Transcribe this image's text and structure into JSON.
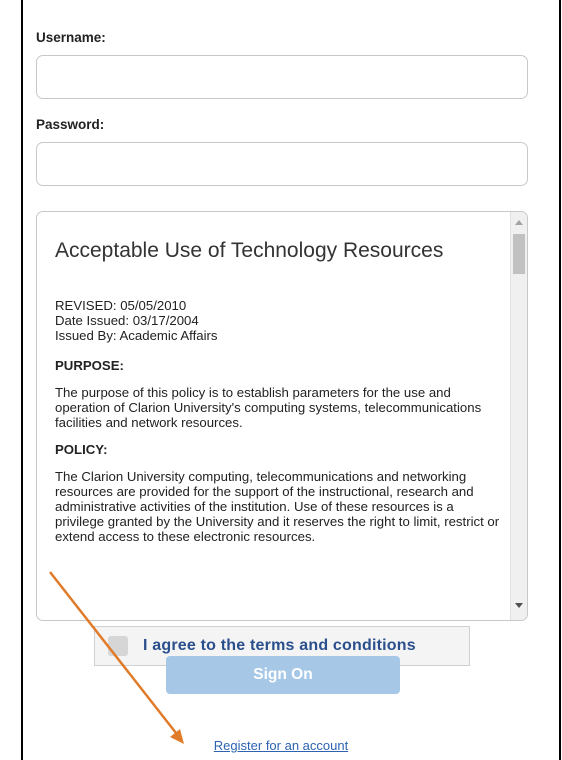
{
  "login": {
    "username_label": "Username:",
    "password_label": "Password:",
    "username_value": "",
    "password_value": ""
  },
  "terms": {
    "title": "Acceptable Use of Technology Resources",
    "revised": "REVISED: 05/05/2010",
    "date_issued": "Date Issued: 03/17/2004",
    "issued_by": "Issued By: Academic Affairs",
    "purpose_heading": "PURPOSE:",
    "purpose_text": "The purpose of this policy is to establish parameters for the use and operation of Clarion University's computing systems, telecommunications facilities and network resources.",
    "policy_heading": "POLICY:",
    "policy_text": "The Clarion University computing, telecommunications and networking resources are provided for the support of the instructional, research and administrative activities of the institution.  Use of these resources is a privilege granted by the University and it reserves the right to limit, restrict or extend access to these electronic resources."
  },
  "agree_label": "I agree to the terms and conditions",
  "signon_label": "Sign On",
  "register_link": "Register for an account",
  "colors": {
    "annotation_arrow": "#e07b2a",
    "signon_button": "#a6c8e6",
    "agree_text": "#2a4f8c",
    "link": "#2d63b2"
  }
}
